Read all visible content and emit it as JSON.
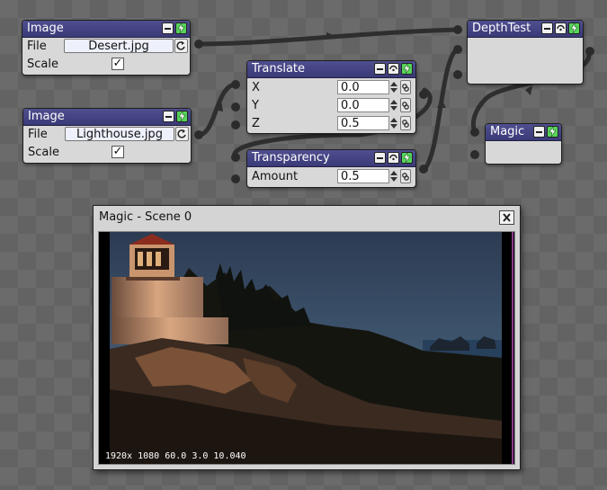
{
  "nodes": {
    "image1": {
      "title": "Image",
      "file_label": "File",
      "file_value": "Desert.jpg",
      "scale_label": "Scale",
      "scale_checked": "✓"
    },
    "image2": {
      "title": "Image",
      "file_label": "File",
      "file_value": "Lighthouse.jpg",
      "scale_label": "Scale",
      "scale_checked": "✓"
    },
    "translate": {
      "title": "Translate",
      "params": [
        {
          "label": "X",
          "value": "0.0"
        },
        {
          "label": "Y",
          "value": "0.0"
        },
        {
          "label": "Z",
          "value": "0.5"
        }
      ]
    },
    "transparency": {
      "title": "Transparency",
      "amount_label": "Amount",
      "amount_value": "0.5"
    },
    "depthtest": {
      "title": "DepthTest"
    },
    "magic": {
      "title": "Magic"
    }
  },
  "preview_window": {
    "title": "Magic - Scene 0",
    "status": "1920x 1080  60.0  3.0 10.040"
  },
  "colors": {
    "header": "#3f3f7e",
    "run_button": "#56d45a",
    "node_body": "#d8d8d8",
    "wire": "#2e2e2e"
  }
}
